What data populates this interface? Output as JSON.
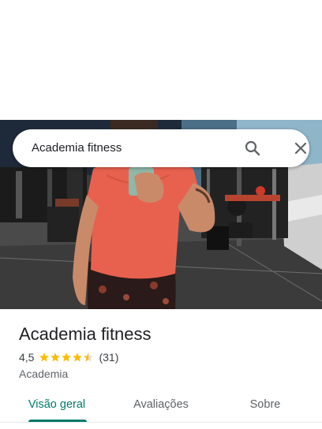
{
  "search": {
    "query": "Academia fitness",
    "search_icon": "search-icon",
    "close_icon": "close-icon"
  },
  "photo": {
    "description_icon": "place-photo"
  },
  "place": {
    "name": "Academia fitness",
    "rating": "4,5",
    "rating_stars": 4.5,
    "review_count": "(31)",
    "category": "Academia"
  },
  "tabs": [
    {
      "label": "Visão geral",
      "active": true
    },
    {
      "label": "Avaliações",
      "active": false
    },
    {
      "label": "Sobre",
      "active": false
    }
  ],
  "colors": {
    "accent": "#00796b",
    "star": "#fbbc04",
    "shirt": "#e8614f"
  }
}
